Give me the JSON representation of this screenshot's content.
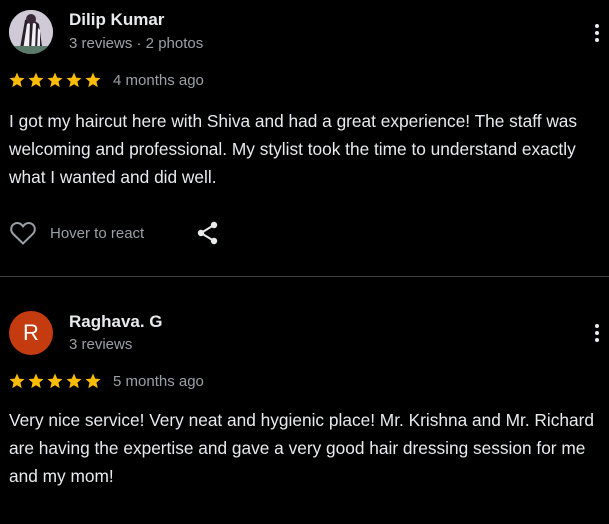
{
  "reviews": [
    {
      "author": "Dilip Kumar",
      "meta": "3 reviews · 2 photos",
      "avatar_type": "photo",
      "avatar_letter": "",
      "rating": 5,
      "time": "4 months ago",
      "text": "I got my haircut here with Shiva and had a great experience! The staff was welcoming and professional. My stylist took the time to understand exactly what I wanted and did well.",
      "react_label": "Hover to react"
    },
    {
      "author": "Raghava. G",
      "meta": "3 reviews",
      "avatar_type": "letter",
      "avatar_letter": "R",
      "avatar_color": "#c43b10",
      "rating": 5,
      "time": "5 months ago",
      "text": "Very nice service! Very neat and hygienic place! Mr. Krishna and Mr. Richard are having the expertise and gave a very good hair dressing session for me and my mom!",
      "react_label": ""
    }
  ],
  "colors": {
    "background": "#000000",
    "star": "#fbbc04",
    "text_primary": "#e8eaed",
    "text_secondary": "#9aa0a6",
    "divider": "#3c4043"
  },
  "icons": {
    "react": "heart-outline-icon",
    "share": "share-icon",
    "more": "more-vert-icon",
    "star": "star-icon"
  }
}
